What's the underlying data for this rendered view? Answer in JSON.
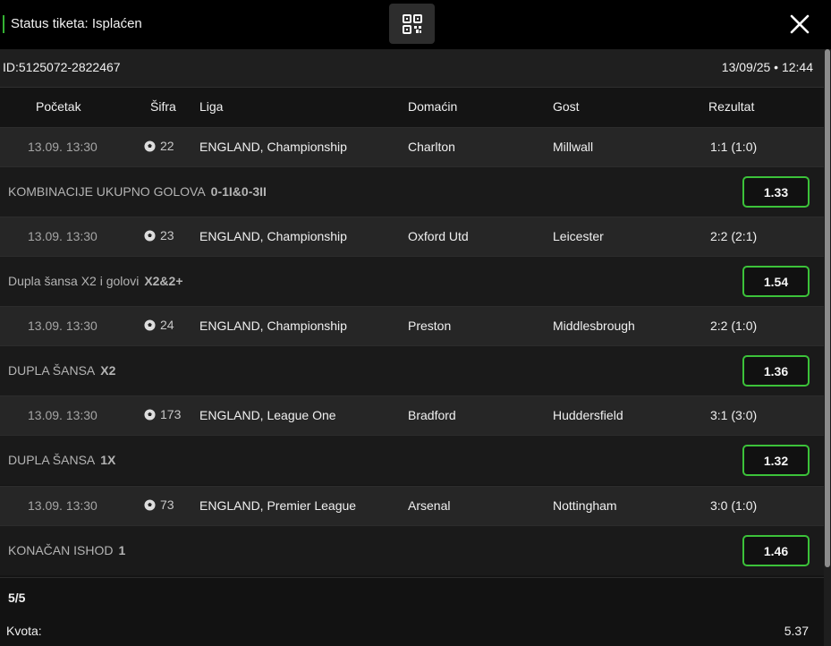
{
  "header": {
    "status": "Status tiketa: Isplaćen",
    "qr_icon": "qr-code-icon",
    "close_icon": "close-icon"
  },
  "ticket": {
    "id": "ID:5125072-2822467",
    "datetime": "13/09/25 • 12:44"
  },
  "columns": {
    "start": "Početak",
    "code": "Šifra",
    "league": "Liga",
    "home": "Domaćin",
    "away": "Gost",
    "result": "Rezultat"
  },
  "events": [
    {
      "time": "13.09. 13:30",
      "code": "22",
      "league": "ENGLAND, Championship",
      "home": "Charlton",
      "away": "Millwall",
      "result": "1:1 (1:0)",
      "bet_type": "KOMBINACIJE UKUPNO GOLOVA",
      "pick": "0-1I&0-3II",
      "odd": "1.33"
    },
    {
      "time": "13.09. 13:30",
      "code": "23",
      "league": "ENGLAND, Championship",
      "home": "Oxford Utd",
      "away": "Leicester",
      "result": "2:2 (2:1)",
      "bet_type": "Dupla šansa X2 i golovi",
      "pick": "X2&2+",
      "odd": "1.54"
    },
    {
      "time": "13.09. 13:30",
      "code": "24",
      "league": "ENGLAND, Championship",
      "home": "Preston",
      "away": "Middlesbrough",
      "result": "2:2 (1:0)",
      "bet_type": "DUPLA ŠANSA",
      "pick": "X2",
      "odd": "1.36"
    },
    {
      "time": "13.09. 13:30",
      "code": "173",
      "league": "ENGLAND, League One",
      "home": "Bradford",
      "away": "Huddersfield",
      "result": "3:1 (3:0)",
      "bet_type": "DUPLA ŠANSA",
      "pick": "1X",
      "odd": "1.32"
    },
    {
      "time": "13.09. 13:30",
      "code": "73",
      "league": "ENGLAND, Premier League",
      "home": "Arsenal",
      "away": "Nottingham",
      "result": "3:0 (1:0)",
      "bet_type": "KONAČAN ISHOD",
      "pick": "1",
      "odd": "1.46"
    }
  ],
  "footer": {
    "count": "5/5",
    "kvota_label": "Kvota:",
    "kvota_value": "5.37"
  },
  "colors": {
    "accent_green": "#3cc23a",
    "background": "#141414"
  }
}
